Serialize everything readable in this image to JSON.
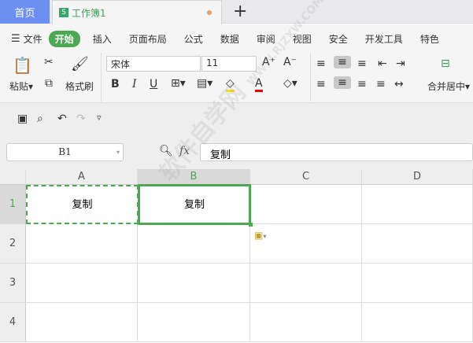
{
  "tabs": {
    "home": "首页",
    "doc": "工作簿1",
    "sheet_icon": "S",
    "new_tab": "+"
  },
  "menu": {
    "file": "文件",
    "items": [
      "开始",
      "插入",
      "页面布局",
      "公式",
      "数据",
      "审阅",
      "视图",
      "安全",
      "开发工具",
      "特色"
    ]
  },
  "ribbon": {
    "paste": "粘贴",
    "format_painter": "格式刷",
    "font_name": "宋体",
    "font_size": "11",
    "merge": "合并居中",
    "bold": "B",
    "italic": "I",
    "underline": "U",
    "font_color": "A",
    "grow": "A⁺",
    "shrink": "A⁻"
  },
  "formula": {
    "name_box": "B1",
    "fx": "fx",
    "value": "复制"
  },
  "columns": [
    "A",
    "B",
    "C",
    "D"
  ],
  "rows": [
    "1",
    "2",
    "3",
    "4"
  ],
  "cells": {
    "A1": "复制",
    "B1": "复制"
  },
  "watermark": "软件自学网 WWW.RJZXW.COM",
  "colors": {
    "accent": "#4ca952",
    "home_tab": "#6b8ff2"
  }
}
